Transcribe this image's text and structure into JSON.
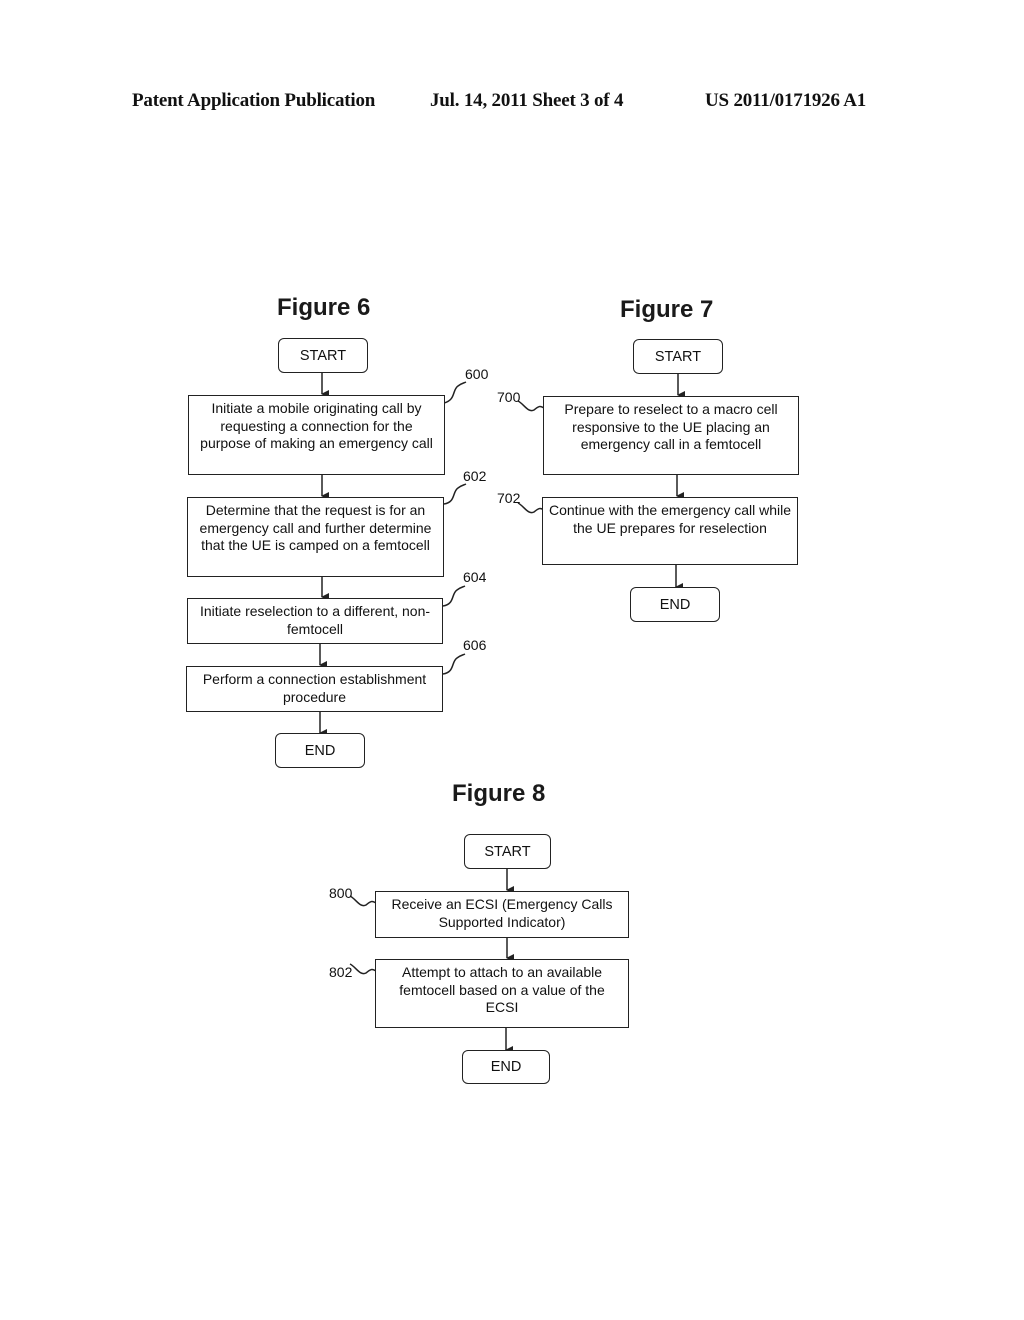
{
  "header": {
    "publication": "Patent Application Publication",
    "date_sheet": "Jul. 14, 2011   Sheet 3 of 4",
    "number": "US 2011/0171926 A1"
  },
  "figures": {
    "fig6": {
      "title": "Figure 6",
      "start": "START",
      "end": "END",
      "steps": [
        {
          "ref": "600",
          "text": "Initiate a mobile originating call by requesting a connection for the purpose of making an emergency call"
        },
        {
          "ref": "602",
          "text": "Determine that the request is for an emergency call and further determine that the UE is camped on a femtocell"
        },
        {
          "ref": "604",
          "text": "Initiate reselection to a different, non-femtocell"
        },
        {
          "ref": "606",
          "text": "Perform a connection establishment procedure"
        }
      ]
    },
    "fig7": {
      "title": "Figure 7",
      "start": "START",
      "end": "END",
      "steps": [
        {
          "ref": "700",
          "text": "Prepare to reselect to a macro cell responsive to the UE placing an emergency call in a femtocell"
        },
        {
          "ref": "702",
          "text": "Continue with the emergency call while the UE prepares for reselection"
        }
      ]
    },
    "fig8": {
      "title": "Figure 8",
      "start": "START",
      "end": "END",
      "steps": [
        {
          "ref": "800",
          "text": "Receive an ECSI (Emergency Calls Supported Indicator)"
        },
        {
          "ref": "802",
          "text": "Attempt to attach to an available femtocell based on a value of the ECSI"
        }
      ]
    }
  }
}
